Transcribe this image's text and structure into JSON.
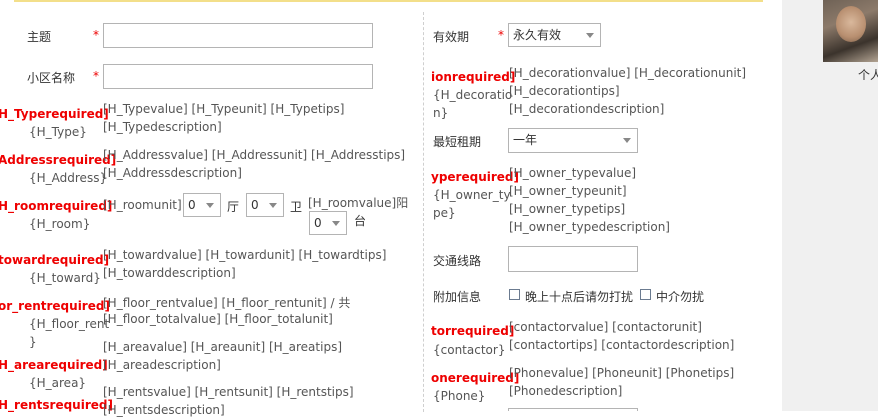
{
  "form": {
    "left": {
      "subject": {
        "label": "主题",
        "required_mark": "*",
        "value": ""
      },
      "community": {
        "label": "小区名称",
        "required_mark": "*",
        "value": ""
      },
      "type": {
        "required": "H_Typerequired]",
        "name": "{H_Type}",
        "line1": "[H_Typevalue] [H_Typeunit] [H_Typetips]",
        "line2": "[H_Typedescription]"
      },
      "address": {
        "required": "Addressrequired]",
        "name": "{H_Address}",
        "line1": "[H_Addressvalue] [H_Addressunit] [H_Addresstips]",
        "line2": "[H_Addressdescription]"
      },
      "room": {
        "required": "H_roomrequired]",
        "name": "{H_room}",
        "unit_label": "[H_roomunit]",
        "select1": "0",
        "hall": "厅",
        "select2": "0",
        "bath": "卫",
        "value_label": "[H_roomvalue]阳",
        "select3": "0",
        "balcony": "台"
      },
      "toward": {
        "required": "towardrequired]",
        "name": "{H_toward}",
        "line1": "[H_towardvalue] [H_towardunit] [H_towardtips]",
        "line2": "[H_towarddescription]"
      },
      "floor_rent": {
        "required": "or_rentrequired]",
        "name": "{H_floor_rent",
        "name2": "}",
        "line1": "[H_floor_rentvalue] [H_floor_rentunit] / 共",
        "line2": "[H_floor_totalvalue] [H_floor_totalunit]"
      },
      "area": {
        "required": "H_arearequired]",
        "name": "{H_area}",
        "line1": "[H_areavalue] [H_areaunit] [H_areatips]",
        "line2": "[H_areadescription]"
      },
      "rents": {
        "required": "H_rentsrequired]",
        "line1": "[H_rentsvalue] [H_rentsunit] [H_rentstips]",
        "line2": "[H_rentsdescription]"
      }
    },
    "right": {
      "validity": {
        "label": "有效期",
        "required_mark": "*",
        "selected": "永久有效"
      },
      "decoration": {
        "required": "ionrequired]",
        "name": "{H_decoratio",
        "name2": "n}",
        "line1": "[H_decorationvalue] [H_decorationunit]",
        "line2": "[H_decorationtips]",
        "line3": "[H_decorationdescription]"
      },
      "min_rent": {
        "label": "最短租期",
        "selected": "一年"
      },
      "owner_type": {
        "required": "yperequired]",
        "name": "{H_owner_ty",
        "name2": "pe}",
        "line1": "[H_owner_typevalue]",
        "line2": "[H_owner_typeunit]",
        "line3": "[H_owner_typetips]",
        "line4": "[H_owner_typedescription]"
      },
      "traffic": {
        "label": "交通线路",
        "value": ""
      },
      "extra": {
        "label": "附加信息",
        "option1": "晚上十点后请勿打扰",
        "option2": "中介勿扰"
      },
      "contactor": {
        "required": "torrequired]",
        "name": "{contactor}",
        "line1": "[contactorvalue] [contactorunit]",
        "line2": "[contactortips] [contactordescription]"
      },
      "phone": {
        "required": "onerequired]",
        "name": "{Phone}",
        "line1": "[Phonevalue] [Phoneunit] [Phonetips]",
        "line2": "[Phonedescription]"
      }
    }
  },
  "sidebar": {
    "person_label": "个人"
  }
}
